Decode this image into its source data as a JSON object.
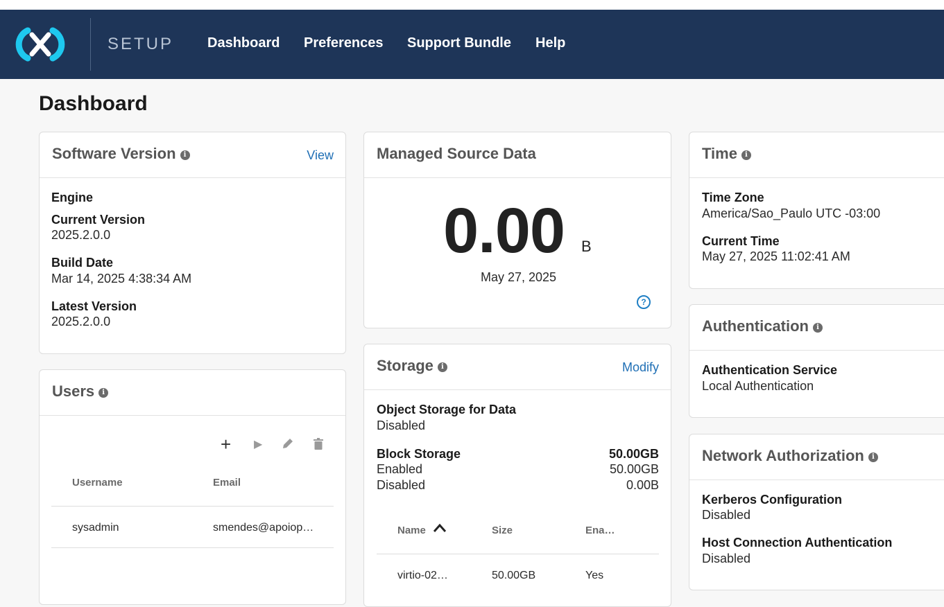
{
  "navbar": {
    "app_name": "SETUP",
    "links": [
      "Dashboard",
      "Preferences",
      "Support Bundle",
      "Help"
    ]
  },
  "page": {
    "title": "Dashboard"
  },
  "software_version": {
    "title": "Software Version",
    "action": "View",
    "section": "Engine",
    "current_version_label": "Current Version",
    "current_version": "2025.2.0.0",
    "build_date_label": "Build Date",
    "build_date": "Mar 14, 2025 4:38:34 AM",
    "latest_version_label": "Latest Version",
    "latest_version": "2025.2.0.0"
  },
  "users": {
    "title": "Users",
    "columns": [
      "Username",
      "Email"
    ],
    "rows": [
      {
        "username": "sysadmin",
        "email": "smendes@apoiop…"
      }
    ]
  },
  "managed_source_data": {
    "title": "Managed Source Data",
    "value": "0.00",
    "unit": "B",
    "date": "May 27, 2025",
    "help": "?"
  },
  "storage": {
    "title": "Storage",
    "action": "Modify",
    "object_storage_label": "Object Storage for Data",
    "object_storage_value": "Disabled",
    "block_storage_label": "Block Storage",
    "block_storage_total": "50.00GB",
    "enabled_label": "Enabled",
    "enabled_value": "50.00GB",
    "disabled_label": "Disabled",
    "disabled_value": "0.00B",
    "columns": [
      "Name",
      "Size",
      "Ena…"
    ],
    "rows": [
      {
        "name": "virtio-02…",
        "size": "50.00GB",
        "enabled": "Yes"
      }
    ]
  },
  "time": {
    "title": "Time",
    "zone_label": "Time Zone",
    "zone_value": "America/Sao_Paulo UTC -03:00",
    "current_label": "Current Time",
    "current_value": "May 27, 2025 11:02:41 AM"
  },
  "authentication": {
    "title": "Authentication",
    "service_label": "Authentication Service",
    "service_value": "Local Authentication"
  },
  "network_authorization": {
    "title": "Network Authorization",
    "kerberos_label": "Kerberos Configuration",
    "kerberos_value": "Disabled",
    "host_label": "Host Connection Authentication",
    "host_value": "Disabled"
  },
  "icons": {
    "logo": "brand-logo",
    "info": "info-icon",
    "add": "plus-icon",
    "run": "play-icon",
    "edit": "pencil-icon",
    "delete": "trash-icon",
    "sort": "sort-ascending-icon",
    "help": "help-circle-icon"
  },
  "colors": {
    "navbar": "#1e3558",
    "logo": "#1ec8ef",
    "link_accent": "#1f6fb5"
  }
}
